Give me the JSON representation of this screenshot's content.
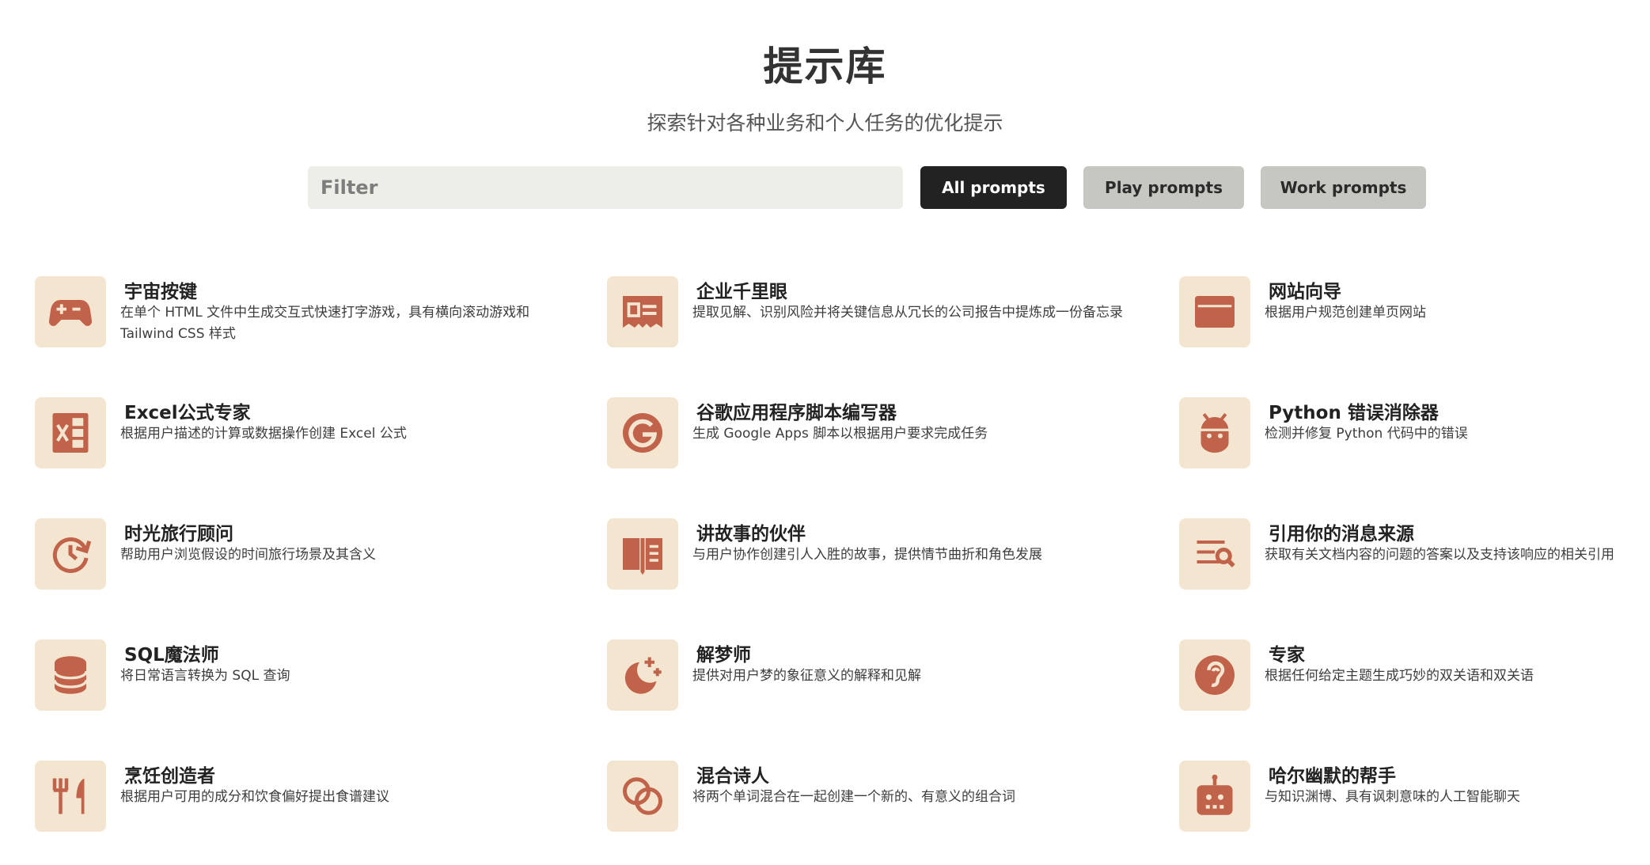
{
  "header": {
    "title": "提示库",
    "subtitle": "探索针对各种业务和个人任务的优化提示"
  },
  "filter": {
    "placeholder": "Filter",
    "value": ""
  },
  "tabs": [
    {
      "label": "All prompts",
      "active": true
    },
    {
      "label": "Play prompts",
      "active": false
    },
    {
      "label": "Work prompts",
      "active": false
    }
  ],
  "colors": {
    "accent": "#c0634a",
    "icon_tile": "#f3e5d0",
    "active_tab": "#222222",
    "inactive_tab": "#c7c7c2",
    "filter_bg": "#eeeee9"
  },
  "prompts": [
    {
      "title": "宇宙按键",
      "description": "在单个 HTML 文件中生成交互式快速打字游戏，具有横向滚动游戏和 Tailwind CSS 样式",
      "icon": "gamepad-icon"
    },
    {
      "title": "企业千里眼",
      "description": "提取见解、识别风险并将关键信息从冗长的公司报告中提炼成一份备忘录",
      "icon": "report-icon"
    },
    {
      "title": "网站向导",
      "description": "根据用户规范创建单页网站",
      "icon": "browser-window-icon"
    },
    {
      "title": "Excel公式专家",
      "description": "根据用户描述的计算或数据操作创建 Excel 公式",
      "icon": "excel-icon"
    },
    {
      "title": "谷歌应用程序脚本编写器",
      "description": "生成 Google Apps 脚本以根据用户要求完成任务",
      "icon": "google-icon"
    },
    {
      "title": "Python 错误消除器",
      "description": "检测并修复 Python 代码中的错误",
      "icon": "bug-icon"
    },
    {
      "title": "时光旅行顾问",
      "description": "帮助用户浏览假设的时间旅行场景及其含义",
      "icon": "time-travel-icon"
    },
    {
      "title": "讲故事的伙伴",
      "description": "与用户协作创建引人入胜的故事，提供情节曲折和角色发展",
      "icon": "book-icon"
    },
    {
      "title": "引用你的消息来源",
      "description": "获取有关文档内容的问题的答案以及支持该响应的相关引用",
      "icon": "search-text-icon"
    },
    {
      "title": "SQL魔法师",
      "description": "将日常语言转换为 SQL 查询",
      "icon": "database-icon"
    },
    {
      "title": "解梦师",
      "description": "提供对用户梦的象征意义的解释和见解",
      "icon": "moon-stars-icon"
    },
    {
      "title": "专家",
      "description": "根据任何给定主题生成巧妙的双关语和双关语",
      "icon": "ear-icon"
    },
    {
      "title": "烹饪创造者",
      "description": "根据用户可用的成分和饮食偏好提出食谱建议",
      "icon": "fork-knife-icon"
    },
    {
      "title": "混合诗人",
      "description": "将两个单词混合在一起创建一个新的、有意义的组合词",
      "icon": "blend-circles-icon"
    },
    {
      "title": "哈尔幽默的帮手",
      "description": "与知识渊博、具有讽刺意味的人工智能聊天",
      "icon": "robot-icon"
    }
  ]
}
